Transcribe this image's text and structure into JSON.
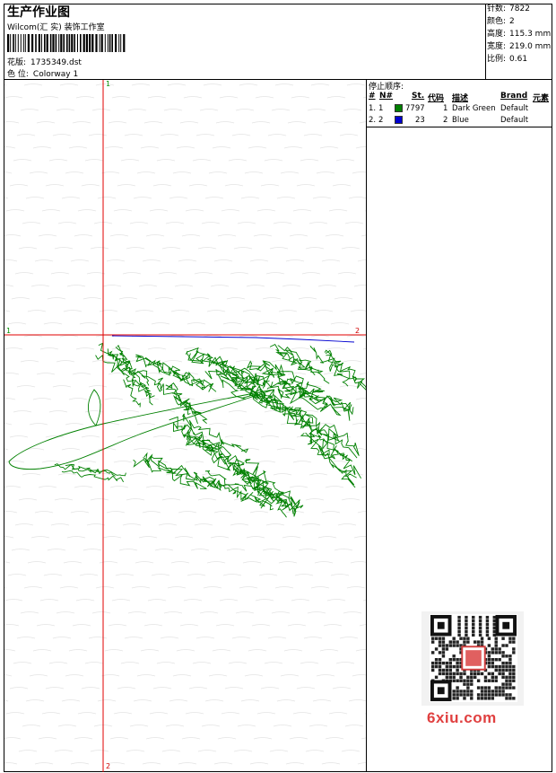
{
  "header": {
    "title": "生产作业图",
    "subtitle": "Wilcom(汇 实) 装饰工作室",
    "design_label": "花版:",
    "design_value": "1735349.dst",
    "colorway_label": "色 位:",
    "colorway_value": "Colorway 1"
  },
  "stats": [
    {
      "label": "针数:",
      "value": "7822"
    },
    {
      "label": "颜色:",
      "value": "2"
    },
    {
      "label": "高度:",
      "value": "115.3 mm"
    },
    {
      "label": "宽度:",
      "value": "219.0 mm"
    },
    {
      "label": "比例:",
      "value": "0.61"
    }
  ],
  "sequence": {
    "title": "停止顺序:",
    "columns": [
      "#",
      "N#",
      "St.",
      "代码",
      "描述",
      "Brand",
      "元素"
    ],
    "rows": [
      {
        "index": "1.",
        "n": "1",
        "color": "#008000",
        "stitches": "7797",
        "code": "1",
        "description": "Dark Green",
        "brand": "Default"
      },
      {
        "index": "2.",
        "n": "2",
        "color": "#0000d0",
        "stitches": "23",
        "code": "2",
        "description": "Blue",
        "brand": "Default"
      }
    ]
  },
  "axes": {
    "vertical_top": "1",
    "vertical_bottom": "2",
    "horizontal_left": "1",
    "horizontal_right": "2"
  },
  "colors": {
    "axis": "#e00000",
    "stitch_green": "#008000",
    "stitch_blue": "#0000d0"
  },
  "watermark": {
    "text": "6xiu.com",
    "qr": "qr-code-icon"
  }
}
